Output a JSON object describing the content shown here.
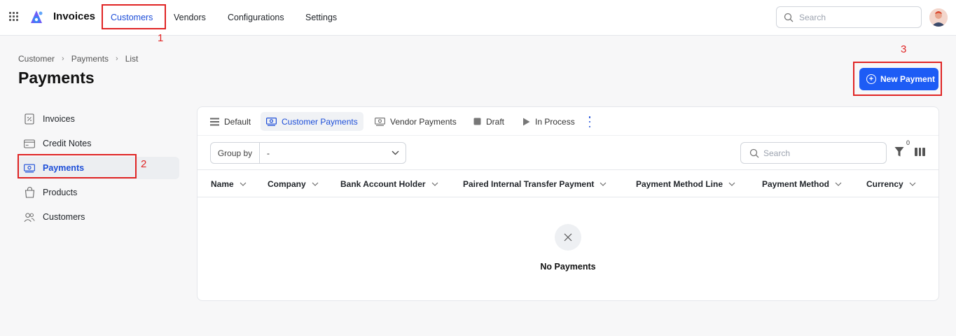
{
  "app": {
    "title": "Invoices"
  },
  "nav": {
    "items": [
      {
        "label": "Customers",
        "active": true
      },
      {
        "label": "Vendors"
      },
      {
        "label": "Configurations"
      },
      {
        "label": "Settings"
      }
    ]
  },
  "top_search": {
    "placeholder": "Search"
  },
  "breadcrumb": [
    "Customer",
    "Payments",
    "List"
  ],
  "page": {
    "title": "Payments",
    "new_button": "New Payment"
  },
  "annotations": [
    "1",
    "2",
    "3"
  ],
  "sidebar": {
    "items": [
      {
        "label": "Invoices",
        "icon": "invoice-icon"
      },
      {
        "label": "Credit Notes",
        "icon": "credit-card-icon"
      },
      {
        "label": "Payments",
        "icon": "payment-icon",
        "active": true
      },
      {
        "label": "Products",
        "icon": "shopping-bag-icon"
      },
      {
        "label": "Customers",
        "icon": "users-icon"
      }
    ]
  },
  "views": [
    {
      "label": "Default",
      "icon": "list-icon"
    },
    {
      "label": "Customer Payments",
      "icon": "payment-icon",
      "active": true
    },
    {
      "label": "Vendor Payments",
      "icon": "payment-icon"
    },
    {
      "label": "Draft",
      "icon": "square-icon"
    },
    {
      "label": "In Process",
      "icon": "play-icon"
    }
  ],
  "group_by": {
    "label": "Group by",
    "value": "-"
  },
  "list_search": {
    "placeholder": "Search"
  },
  "filter": {
    "count": "0"
  },
  "columns": [
    "Name",
    "Company",
    "Bank Account Holder",
    "Paired Internal Transfer Payment",
    "Payment Method Line",
    "Payment Method",
    "Currency"
  ],
  "empty_state": {
    "text": "No Payments"
  },
  "colors": {
    "accent": "#1d5cf5",
    "annotation": "#e02424"
  }
}
